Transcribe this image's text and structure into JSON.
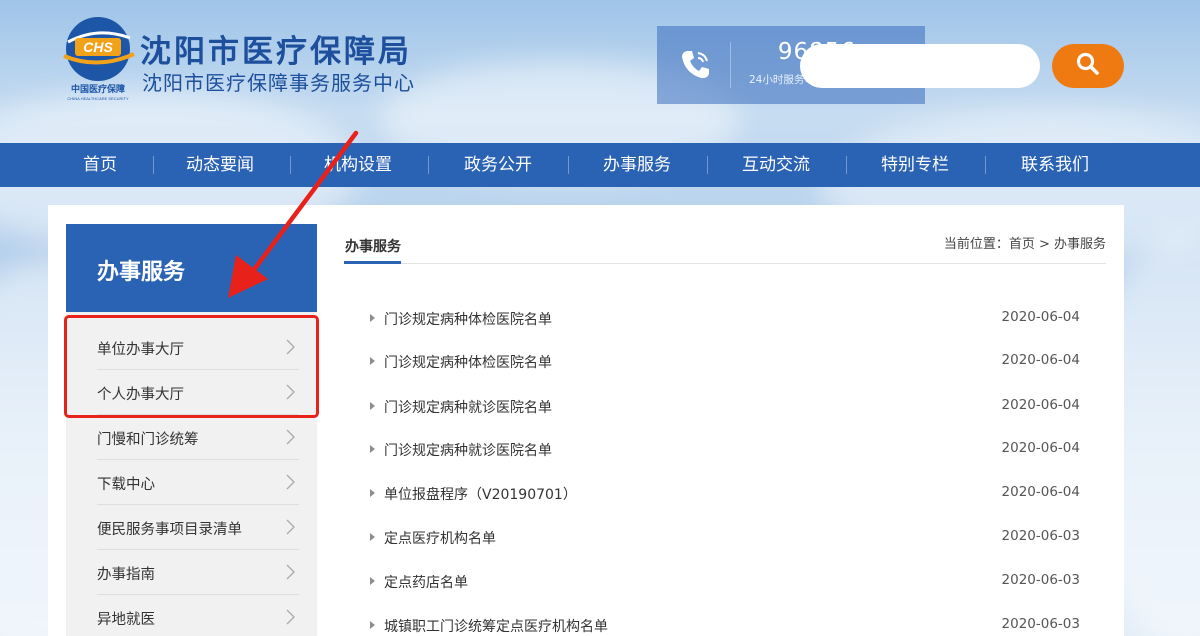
{
  "header": {
    "org_name": "沈阳市医疗保障局",
    "org_sub": "沈阳市医疗保障事务服务中心",
    "emblem_text": "CHS",
    "emblem_caption": "中国医疗保障",
    "emblem_caption_en": "CHINA HEALTHCARE SECURITY"
  },
  "hotline": {
    "number": "96856",
    "desc": "24小时服务电话  医保卡挂失",
    "icon": "phone-icon"
  },
  "search": {
    "placeholder": "",
    "icon": "search-icon",
    "button_color": "#ef7a12"
  },
  "nav": {
    "items": [
      "首页",
      "动态要闻",
      "机构设置",
      "政务公开",
      "办事服务",
      "互动交流",
      "特别专栏",
      "联系我们"
    ]
  },
  "sidebar": {
    "title": "办事服务",
    "items": [
      "单位办事大厅",
      "个人办事大厅",
      "门慢和门诊统筹",
      "下载中心",
      "便民服务事项目录清单",
      "办事指南",
      "异地就医"
    ]
  },
  "main": {
    "section_title": "办事服务",
    "breadcrumb": "当前位置：首页 > 办事服务",
    "articles": [
      {
        "title": "门诊规定病种体检医院名单",
        "date": "2020-06-04"
      },
      {
        "title": "门诊规定病种体检医院名单",
        "date": "2020-06-04"
      },
      {
        "title": "门诊规定病种就诊医院名单",
        "date": "2020-06-04"
      },
      {
        "title": "门诊规定病种就诊医院名单",
        "date": "2020-06-04"
      },
      {
        "title": "单位报盘程序（V20190701）",
        "date": "2020-06-04"
      },
      {
        "title": "定点医疗机构名单",
        "date": "2020-06-03"
      },
      {
        "title": "定点药店名单",
        "date": "2020-06-03"
      },
      {
        "title": "城镇职工门诊统筹定点医疗机构名单",
        "date": "2020-06-03"
      }
    ]
  },
  "colors": {
    "brand_blue": "#2a62b4",
    "accent_orange": "#ef7a12",
    "annotation_red": "#e8221b"
  }
}
